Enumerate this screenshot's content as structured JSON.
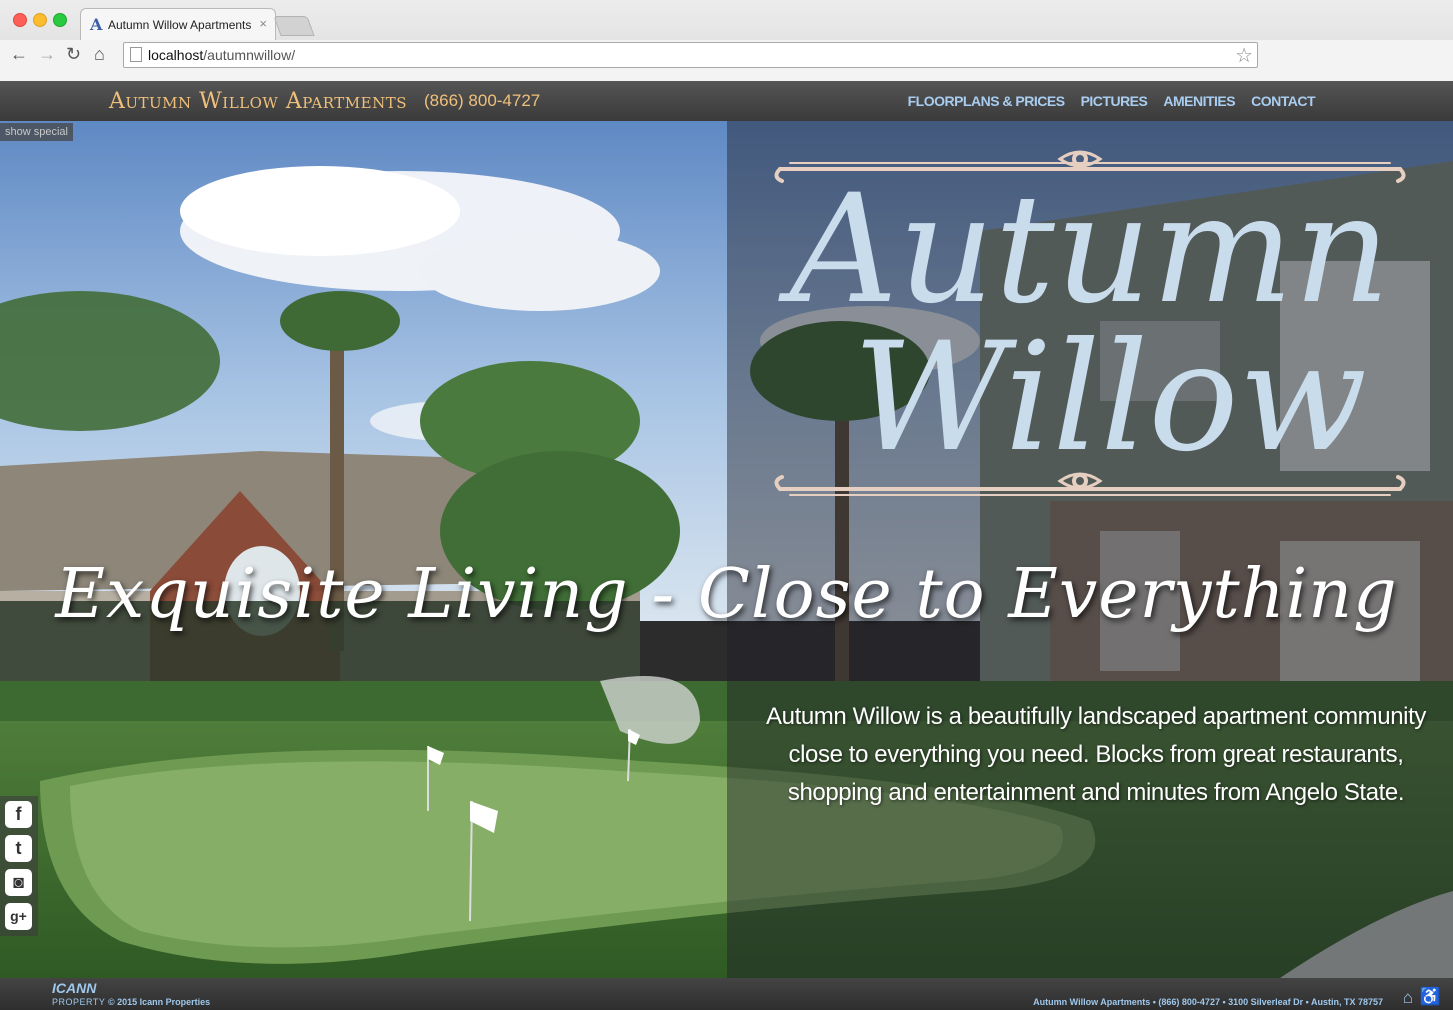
{
  "browser": {
    "tab_title": "Autumn Willow Apartments",
    "tab_favicon": "A",
    "url_host": "localhost",
    "url_path": "/autumnwillow/"
  },
  "header": {
    "brand": "Autumn Willow Apartments",
    "phone": "(866) 800-4727",
    "nav": [
      "Floorplans & Prices",
      "Pictures",
      "Amenities",
      "Contact"
    ]
  },
  "hero": {
    "show_special": "show special",
    "logo_line1": "Autumn",
    "logo_line2": "Willow",
    "tagline": "Exquisite Living - Close to Everything",
    "description": "Autumn Willow is a beautifully landscaped apartment community close to everything you need. Blocks from great restaurants, shopping and entertainment and minutes from Angelo State."
  },
  "social": [
    {
      "icon": "facebook-icon",
      "glyph": "f"
    },
    {
      "icon": "twitter-icon",
      "glyph": "t"
    },
    {
      "icon": "instagram-icon",
      "glyph": "◙"
    },
    {
      "icon": "google-plus-icon",
      "glyph": "g+"
    }
  ],
  "footer": {
    "company_logo": "ICANN",
    "company_sub": "PROPERTY",
    "copyright": "© 2015 Icann Properties",
    "address": "Autumn Willow Apartments • (866) 800-4727 • 3100 Silverleaf Dr • Austin, TX 78757"
  },
  "colors": {
    "brand_gold": "#efc07a",
    "nav_blue": "#a8cdf0",
    "logo_blue": "#c9dcec",
    "ornament": "#e6cfc0"
  }
}
